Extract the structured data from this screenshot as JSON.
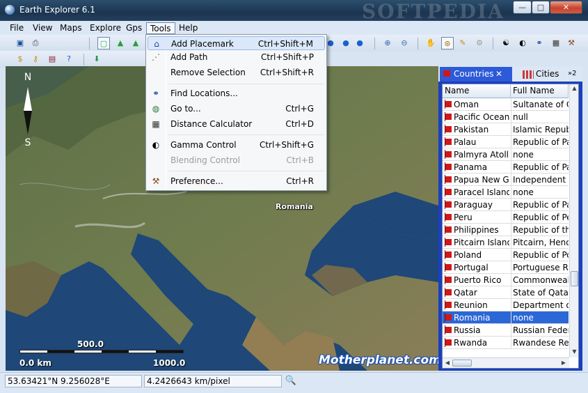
{
  "window": {
    "title": "Earth Explorer 6.1",
    "watermark": "SOFTPEDIA",
    "minimize": "—",
    "maximize": "□",
    "close": "✕"
  },
  "menubar": {
    "items": [
      "File",
      "View",
      "Maps",
      "Explore",
      "Gps",
      "Tools",
      "Help"
    ]
  },
  "tools_menu": {
    "items": [
      {
        "label": "Add Placemark",
        "shortcut": "Ctrl+Shift+M",
        "icon": "home-icon"
      },
      {
        "label": "Add Path",
        "shortcut": "Ctrl+Shift+P",
        "icon": "path-icon"
      },
      {
        "label": "Remove Selection",
        "shortcut": "Ctrl+Shift+R",
        "icon": ""
      },
      {
        "label": "Find Locations...",
        "shortcut": "",
        "icon": "binoculars-icon"
      },
      {
        "label": "Go to...",
        "shortcut": "Ctrl+G",
        "icon": "globe-icon"
      },
      {
        "label": "Distance Calculator",
        "shortcut": "Ctrl+D",
        "icon": "calculator-icon"
      },
      {
        "label": "Gamma Control",
        "shortcut": "Ctrl+Shift+G",
        "icon": "contrast-icon"
      },
      {
        "label": "Blending Control",
        "shortcut": "Ctrl+B",
        "icon": ""
      },
      {
        "label": "Preference...",
        "shortcut": "Ctrl+R",
        "icon": "tools-icon"
      }
    ]
  },
  "map": {
    "compass_n": "N",
    "compass_s": "S",
    "place_label": "Romania",
    "scale_mid": "500.0",
    "scale_left": "0.0 km",
    "scale_right": "1000.0",
    "brand": "Motherplanet.com"
  },
  "panel": {
    "tab_countries": "Countries",
    "tab_countries_close": "✕",
    "tab_cities": "Cities",
    "tab_more": "»2",
    "col_name": "Name",
    "col_full": "Full Name",
    "rows": [
      {
        "name": "Oman",
        "full": "Sultanate of Oman"
      },
      {
        "name": "Pacific Ocean",
        "full": "null"
      },
      {
        "name": "Pakistan",
        "full": "Islamic Republic"
      },
      {
        "name": "Palau",
        "full": "Republic of Palau"
      },
      {
        "name": "Palmyra Atoll",
        "full": "none"
      },
      {
        "name": "Panama",
        "full": "Republic of Panama"
      },
      {
        "name": "Papua New G...",
        "full": "Independent State"
      },
      {
        "name": "Paracel Islands",
        "full": "none"
      },
      {
        "name": "Paraguay",
        "full": "Republic of Paraguay"
      },
      {
        "name": "Peru",
        "full": "Republic of Peru"
      },
      {
        "name": "Philippines",
        "full": "Republic of the"
      },
      {
        "name": "Pitcairn Islands",
        "full": "Pitcairn, Henderson"
      },
      {
        "name": "Poland",
        "full": "Republic of Poland"
      },
      {
        "name": "Portugal",
        "full": "Portuguese Republic"
      },
      {
        "name": "Puerto Rico",
        "full": "Commonwealth"
      },
      {
        "name": "Qatar",
        "full": "State of Qatar"
      },
      {
        "name": "Reunion",
        "full": "Department of"
      },
      {
        "name": "Romania",
        "full": "none"
      },
      {
        "name": "Russia",
        "full": "Russian Federation"
      },
      {
        "name": "Rwanda",
        "full": "Rwandese Republic"
      }
    ],
    "selected_row": "Romania"
  },
  "status": {
    "coordinates": "53.63421°N  9.256028°E",
    "scale": "4.2426643 km/pixel"
  },
  "colors": {
    "accent": "#2c5ad8",
    "selection": "#2c67d8",
    "flag": "#d01818"
  }
}
